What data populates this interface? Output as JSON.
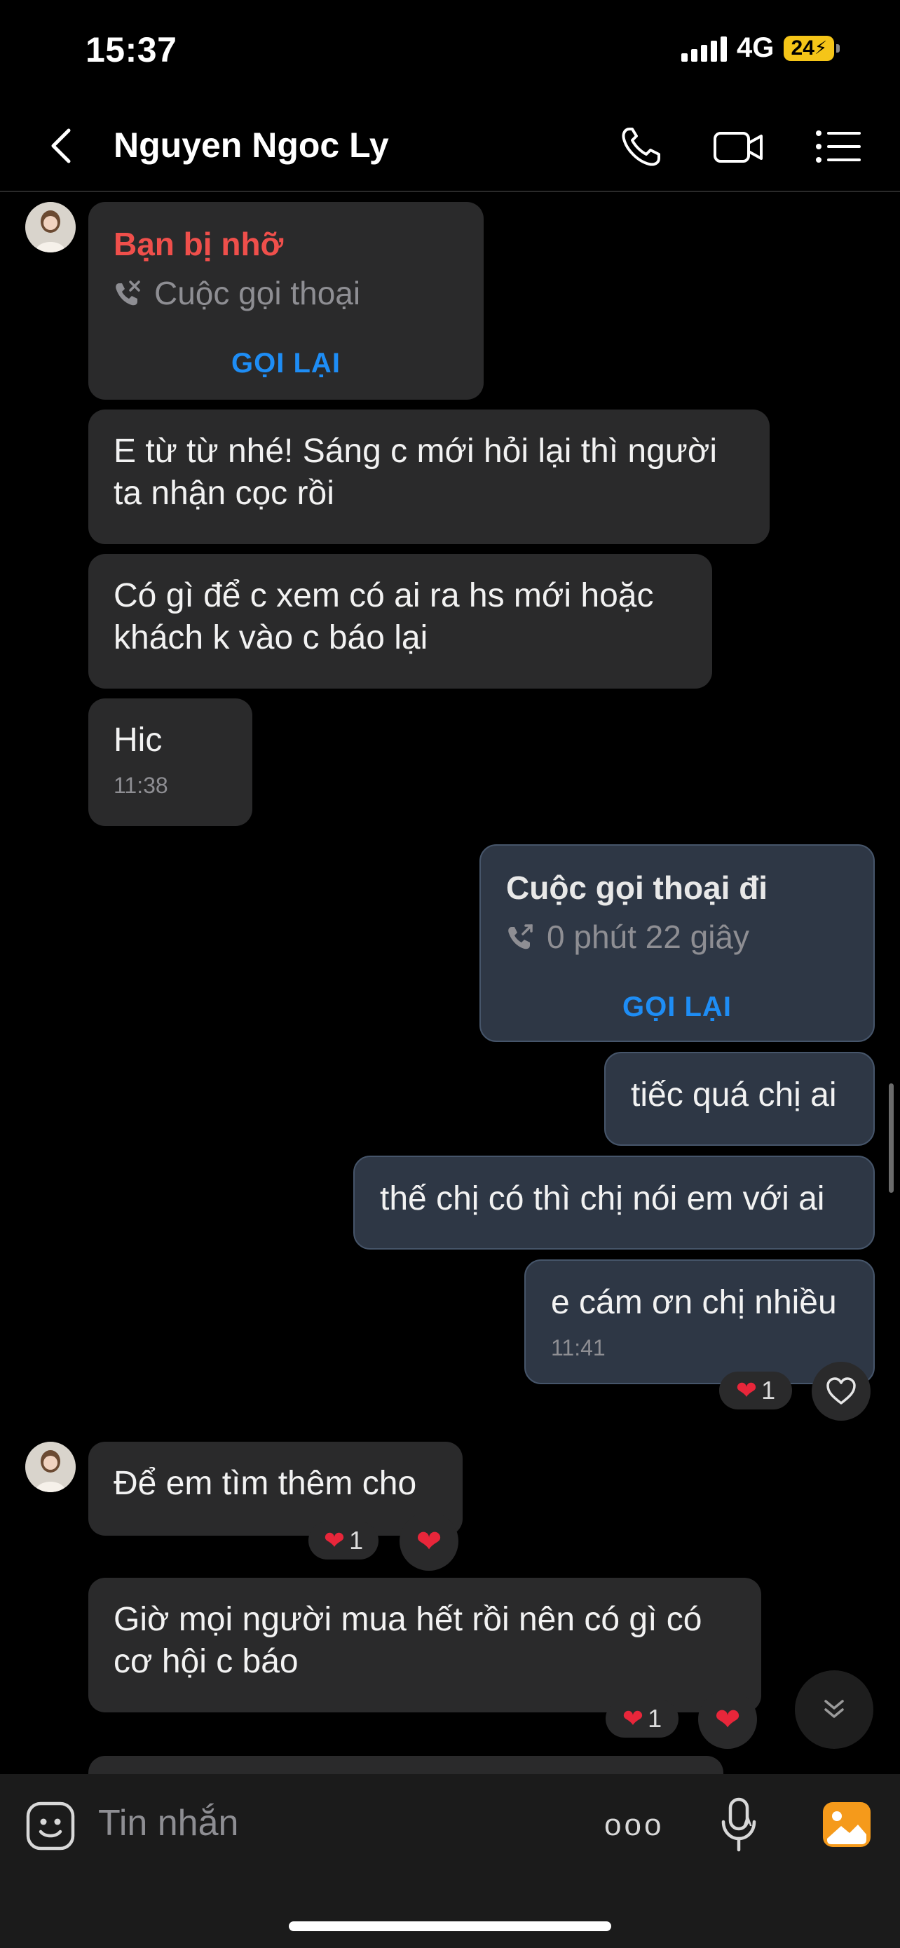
{
  "status_bar": {
    "time": "15:37",
    "network": "4G",
    "battery": "24"
  },
  "header": {
    "contact_name": "Nguyen Ngoc Ly"
  },
  "messages": {
    "missed_call": {
      "title": "Bạn bị nhỡ",
      "subtitle": "Cuộc gọi thoại",
      "action": "GỌI LẠI"
    },
    "m1": {
      "text": "E từ từ nhé! Sáng c mới hỏi lại thì người ta nhận cọc rồi"
    },
    "m2": {
      "text": "Có gì để c xem có ai ra hs mới hoặc khách k vào c báo lại"
    },
    "m3": {
      "text": "Hic",
      "time": "11:38"
    },
    "outgoing_call": {
      "title": "Cuộc gọi thoại đi",
      "subtitle": "0 phút 22 giây",
      "action": "GỌI LẠI"
    },
    "m4": {
      "text": "tiếc quá chị ai"
    },
    "m5": {
      "text": "thế chị có thì chị nói em với ai"
    },
    "m6": {
      "text": "e cám ơn chị nhiều",
      "time": "11:41",
      "reaction_count": "1"
    },
    "m7": {
      "text": "Để em tìm thêm cho",
      "reaction_count": "1"
    },
    "m8": {
      "text": "Giờ mọi người mua hết rồi nên có gì có cơ hội c báo",
      "reaction_count": "1"
    }
  },
  "composer": {
    "placeholder": "Tin nhắn",
    "more_label": "ooo"
  },
  "colors": {
    "background": "#000000",
    "incoming_bubble": "#2a2a2b",
    "outgoing_bubble": "#2e3745",
    "missed_red": "#ef4f4b",
    "action_blue": "#1e8df5",
    "reaction_red": "#e8263a",
    "battery_yellow": "#f5c518",
    "gallery_orange": "#f59a1b"
  }
}
